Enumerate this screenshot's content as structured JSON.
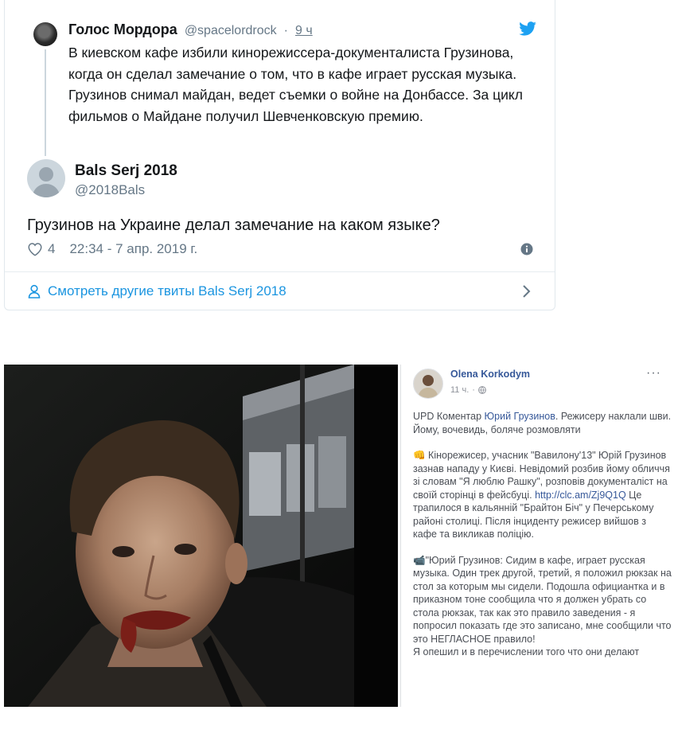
{
  "tweet": {
    "quoted": {
      "name": "Голос Мордора",
      "handle": "@spacelordrock",
      "separator": "·",
      "time": "9 ч",
      "text": "В киевском кафе избили кинорежиссера-документалиста Грузинова, когда он сделал замечание о том, что в кафе играет русская музыка. Грузинов снимал майдан, ведет съемки о войне на Донбассе. За цикл фильмов о Майдане получил Шевченковскую премию."
    },
    "reply": {
      "name": "Bals Serj 2018",
      "handle": "@2018Bals",
      "text": "Грузинов на Украине делал замечание на каком языке?",
      "likes": "4",
      "timestamp": "22:34 - 7 апр. 2019 г."
    },
    "more_link": "Смотреть другие твиты Bals Serj 2018",
    "icons": {
      "bird": "twitter-bird-icon",
      "heart": "heart-icon",
      "info": "info-icon",
      "person": "person-icon",
      "chevron": "chevron-right-icon"
    },
    "colors": {
      "accent": "#1b95e0",
      "muted": "#657786",
      "text": "#14171a"
    }
  },
  "facebook_post": {
    "author": "Olena Korkodym",
    "time": "11 ч.",
    "time_sep": "·",
    "more": "···",
    "p1_prefix": "UPD Коментар ",
    "p1_link": "Юрий Грузинов",
    "p1_suffix": ". Режисеру наклали шви. Йому, вочевидь, боляче розмовляти",
    "p2_emoji": "👊",
    "p2_text": " Кінорежисер, учасник \"Вавилону'13\" Юрій Грузинов зазнав нападу у Києві. Невідомий розбив йому обличчя зі словам \"Я люблю Рашку\", розповів документаліст на своїй сторінці в фейсбуці. ",
    "p2_link": "http://clc.am/Zj9Q1Q",
    "p2_suffix": " Це трапилося в кальянній \"Брайтон Біч\" у Печерському районі столиці. Після інциденту режисер вийшов з кафе та викликав поліцію.",
    "p3_emoji": "📹",
    "p3_text": "\"Юрий Грузинов: Сидим в кафе, играет русская музыка. Один трек другой, третий, я положил рюкзак на стол за которым мы сидели. Подошла официантка и в приказном тоне сообщила что я должен убрать со стола рюкзак, так как это правило заведения - я попросил показать где это записано, мне сообщили что это НЕГЛАСНОЕ правило!",
    "p4_text": "Я опешил и в перечислении того что они делают",
    "icons": {
      "globe": "globe-icon"
    },
    "colors": {
      "name": "#365899",
      "body": "#4b4f56"
    }
  }
}
